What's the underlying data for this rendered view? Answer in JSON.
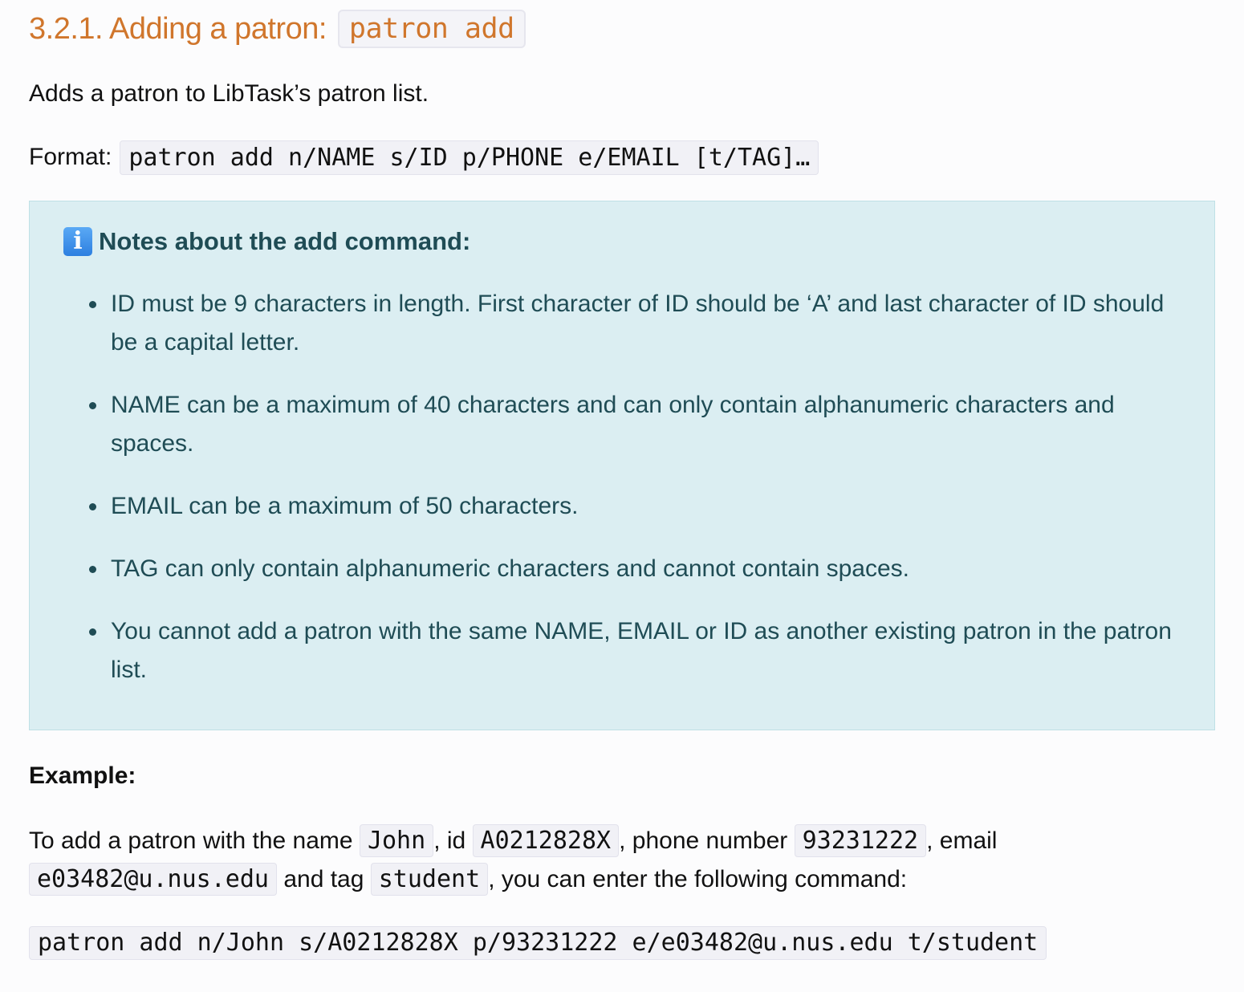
{
  "heading": {
    "text": "3.2.1. Adding a patron:",
    "code": "patron add"
  },
  "description": "Adds a patron to LibTask’s patron list.",
  "format": {
    "label": "Format:",
    "code": "patron add n/NAME s/ID p/PHONE e/EMAIL [t/TAG]…"
  },
  "note": {
    "icon": "info-icon",
    "icon_glyph": "i",
    "title": "Notes about the add command:",
    "items": [
      "ID must be 9 characters in length. First character of ID should be ‘A’ and last character of ID should be a capital letter.",
      "NAME can be a maximum of 40 characters and can only contain alphanumeric characters and spaces.",
      "EMAIL can be a maximum of 50 characters.",
      "TAG can only contain alphanumeric characters and cannot contain spaces.",
      "You cannot add a patron with the same NAME, EMAIL or ID as another existing patron in the patron list."
    ]
  },
  "example": {
    "label": "Example:",
    "t1": "To add a patron with the name ",
    "name": "John",
    "t2": ", id ",
    "id": "A0212828X",
    "t3": ", phone number ",
    "phone": "93231222",
    "t4": ", email ",
    "email": "e03482@u.nus.edu",
    "t5": " and tag ",
    "tag": "student",
    "t6": ", you can enter the following command:",
    "command": "patron add n/John s/A0212828X p/93231222 e/e03482@u.nus.edu t/student"
  },
  "colors": {
    "heading": "#d0762c",
    "note_background": "#dbeef2",
    "note_text": "#1f4c55",
    "code_background": "#f1f1f6"
  }
}
